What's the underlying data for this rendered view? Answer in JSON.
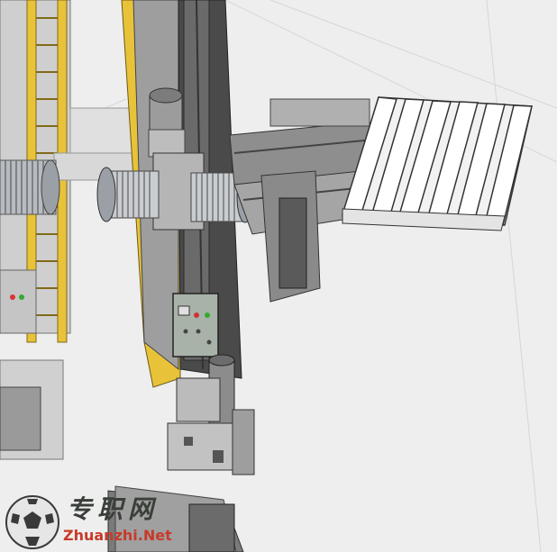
{
  "view": {
    "background": "#ffffff",
    "floor": "#eaeaea",
    "frame_color": "#e8c33a"
  },
  "watermark": {
    "logo_icon": "soccer-ball-globe-icon",
    "cn_text": "专职网",
    "en_text": "Zhuanzhi.Net",
    "en_color": "#c83a2a"
  }
}
